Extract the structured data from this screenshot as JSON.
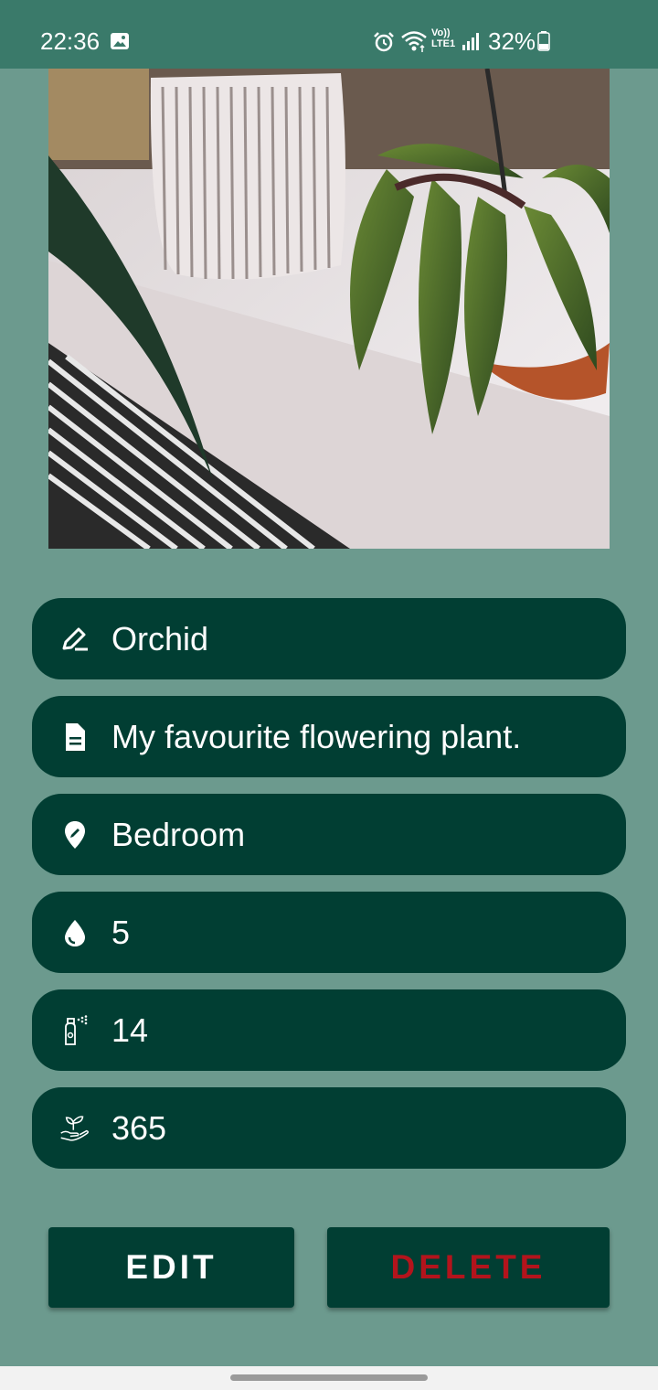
{
  "status_bar": {
    "time": "22:36",
    "volte_line1": "Vo))",
    "volte_line2": "LTE1",
    "battery_percent": "32%"
  },
  "plant": {
    "name": "Orchid",
    "description": "My favourite flowering plant.",
    "location": "Bedroom",
    "water_days": "5",
    "mist_days": "14",
    "repot_days": "365"
  },
  "buttons": {
    "edit_label": "EDIT",
    "delete_label": "DELETE"
  },
  "colors": {
    "background": "#6c9a8e",
    "status_bar": "#3a7a6a",
    "field_bg": "#013e33",
    "delete_text": "#b3141c"
  }
}
